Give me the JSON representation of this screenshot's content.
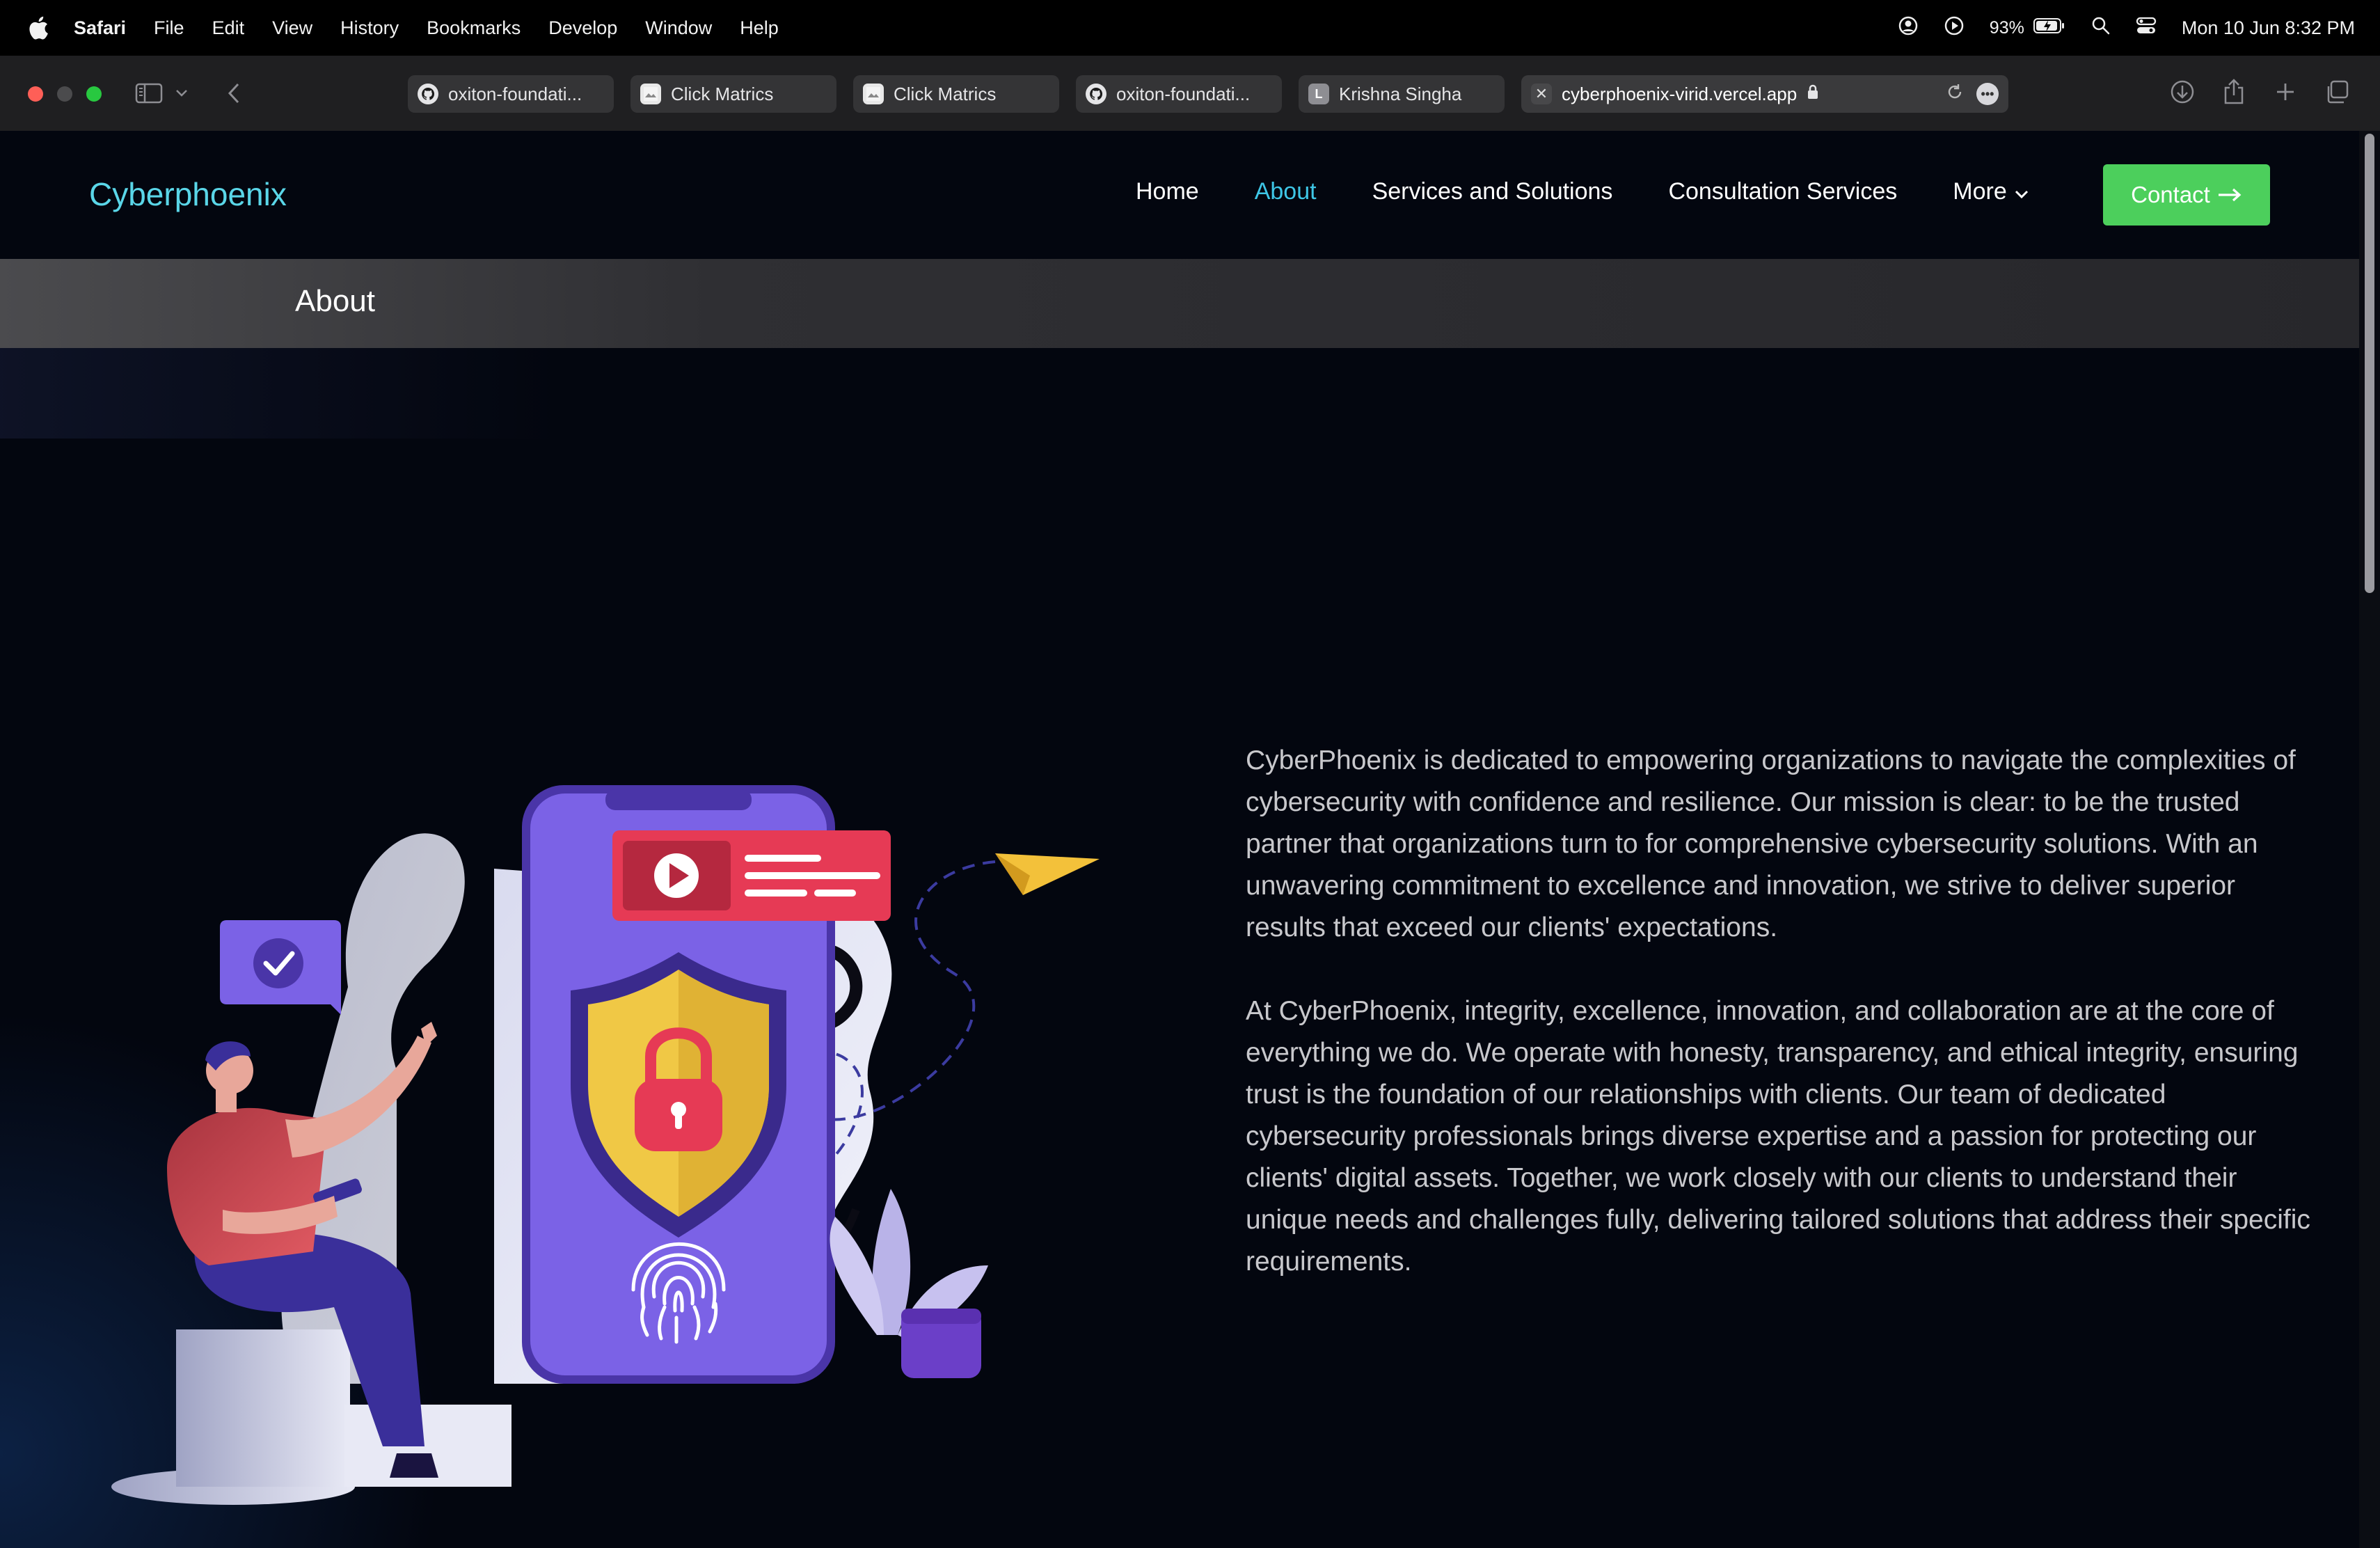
{
  "menubar": {
    "app": "Safari",
    "items": [
      "File",
      "Edit",
      "View",
      "History",
      "Bookmarks",
      "Develop",
      "Window",
      "Help"
    ],
    "battery": "93%",
    "clock": "Mon 10 Jun  8:32 PM"
  },
  "tabs": [
    {
      "title": "oxiton-foundati...",
      "icon": "github-icon"
    },
    {
      "title": "Click Matrics",
      "icon": "page-icon"
    },
    {
      "title": "Click Matrics",
      "icon": "page-icon"
    },
    {
      "title": "oxiton-foundati...",
      "icon": "github-icon"
    },
    {
      "title": "Krishna Singha",
      "icon": "letter-l-icon",
      "letter": "L"
    },
    {
      "title": "cyberphoenix-virid.vercel.app",
      "icon": "close-icon",
      "active": true
    }
  ],
  "site": {
    "logo": "Cyberphoenix",
    "nav": {
      "home": "Home",
      "about": "About",
      "services": "Services and Solutions",
      "consultation": "Consultation Services",
      "more": "More",
      "contact": "Contact"
    },
    "banner_title": "About",
    "paragraphs": [
      "CyberPhoenix is dedicated to empowering organizations to navigate the complexities of cybersecurity with confidence and resilience. Our mission is clear: to be the trusted partner that organizations turn to for comprehensive cybersecurity solutions. With an unwavering commitment to excellence and innovation, we strive to deliver superior results that exceed our clients' expectations.",
      "At CyberPhoenix, integrity, excellence, innovation, and collaboration are at the core of everything we do. We operate with honesty, transparency, and ethical integrity, ensuring trust is the foundation of our relationships with clients. Our team of dedicated cybersecurity professionals brings diverse expertise and a passion for protecting our clients' digital assets. Together, we work closely with our clients to understand their unique needs and challenges fully, delivering tailored solutions that address their specific requirements."
    ]
  },
  "colors": {
    "accent": "#3ec6e6",
    "logo": "#5ad6e8",
    "contact_button": "#4ccf5c",
    "page_bg": "#03060f"
  }
}
